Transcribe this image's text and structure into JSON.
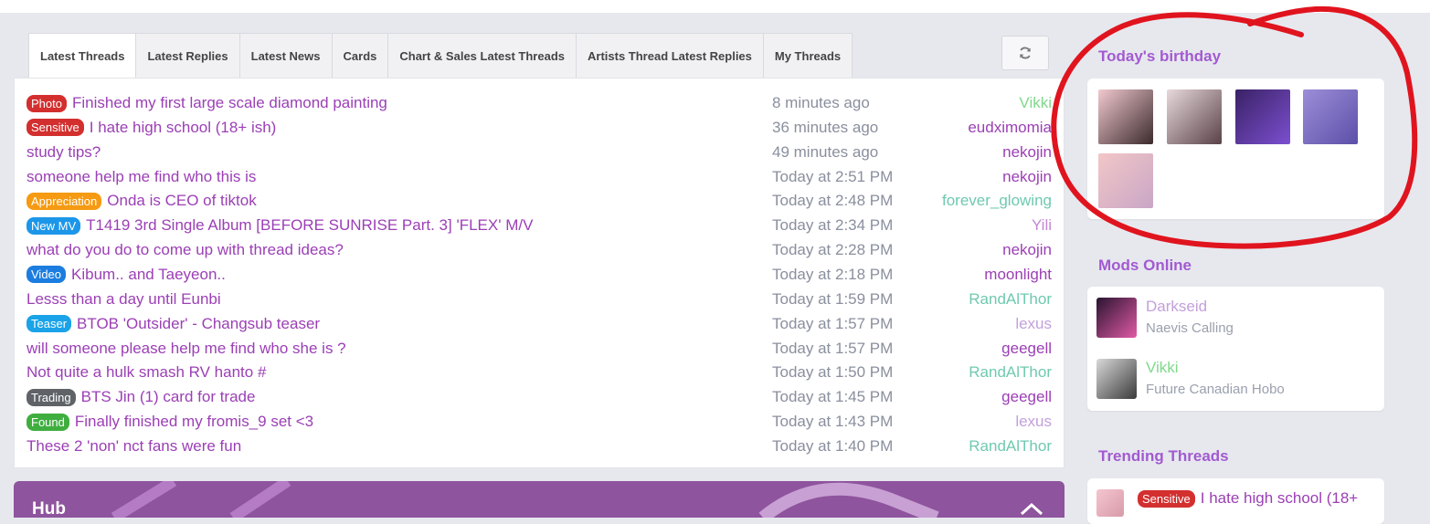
{
  "tabs": [
    "Latest Threads",
    "Latest Replies",
    "Latest News",
    "Cards",
    "Chart & Sales Latest Threads",
    "Artists Thread Latest Replies",
    "My Threads"
  ],
  "refresh_icon": "refresh-icon",
  "threads": [
    {
      "badge": "Photo",
      "badge_color": "#d32f2f",
      "title": "Finished my first large scale diamond painting",
      "time": "8 minutes ago",
      "user": "Vikki",
      "user_color": "#7fd98a"
    },
    {
      "badge": "Sensitive",
      "badge_color": "#d32f2f",
      "title": "I hate high school (18+ ish)",
      "time": "36 minutes ago",
      "user": "eudximomia",
      "user_color": "#9b3fb5"
    },
    {
      "badge": "",
      "badge_color": "",
      "title": "study tips?",
      "time": "49 minutes ago",
      "user": "nekojin",
      "user_color": "#9b3fb5"
    },
    {
      "badge": "",
      "badge_color": "",
      "title": "someone help me find who this is",
      "time": "Today at 2:51 PM",
      "user": "nekojin",
      "user_color": "#9b3fb5"
    },
    {
      "badge": "Appreciation",
      "badge_color": "#f59a12",
      "title": "Onda is CEO of tiktok",
      "time": "Today at 2:48 PM",
      "user": "forever_glowing",
      "user_color": "#6fc9b0"
    },
    {
      "badge": "New MV",
      "badge_color": "#1c96e8",
      "title": "T1419 3rd Single Album [BEFORE SUNRISE Part. 3] 'FLEX' M/V",
      "time": "Today at 2:34 PM",
      "user": "Yili",
      "user_color": "#c486d6"
    },
    {
      "badge": "",
      "badge_color": "",
      "title": "what do you do to come up with thread ideas?",
      "time": "Today at 2:28 PM",
      "user": "nekojin",
      "user_color": "#9b3fb5"
    },
    {
      "badge": "Video",
      "badge_color": "#1c7de0",
      "title": "Kibum.. and Taeyeon..",
      "time": "Today at 2:18 PM",
      "user": "moonlight",
      "user_color": "#9b3fb5"
    },
    {
      "badge": "",
      "badge_color": "",
      "title": "Lesss than a day until Eunbi",
      "time": "Today at 1:59 PM",
      "user": "RandAlThor",
      "user_color": "#6fc9b0"
    },
    {
      "badge": "Teaser",
      "badge_color": "#1aa3e8",
      "title": "BTOB 'Outsider' - Changsub teaser",
      "time": "Today at 1:57 PM",
      "user": "lexus",
      "user_color": "#c3a0dc"
    },
    {
      "badge": "",
      "badge_color": "",
      "title": "will someone please help me find who she is ?",
      "time": "Today at 1:57 PM",
      "user": "geegell",
      "user_color": "#9b3fb5"
    },
    {
      "badge": "",
      "badge_color": "",
      "title": "Not quite a hulk smash RV hanto #",
      "time": "Today at 1:50 PM",
      "user": "RandAlThor",
      "user_color": "#6fc9b0"
    },
    {
      "badge": "Trading",
      "badge_color": "#5f6368",
      "title": "BTS Jin (1) card for trade",
      "time": "Today at 1:45 PM",
      "user": "geegell",
      "user_color": "#9b3fb5"
    },
    {
      "badge": "Found",
      "badge_color": "#3fae3f",
      "title": "Finally finished my fromis_9 set <3",
      "time": "Today at 1:43 PM",
      "user": "lexus",
      "user_color": "#c3a0dc"
    },
    {
      "badge": "",
      "badge_color": "",
      "title": "These 2 'non' nct fans were fun",
      "time": "Today at 1:40 PM",
      "user": "RandAlThor",
      "user_color": "#6fc9b0"
    }
  ],
  "hub": {
    "title": "Hub"
  },
  "sidebar": {
    "birthday_heading": "Today's birthday",
    "birthday_avatars": [
      {
        "name": "birthday-avatar-1",
        "colors": [
          "#f1c9cf",
          "#3b2a2c"
        ]
      },
      {
        "name": "birthday-avatar-2",
        "colors": [
          "#e7d9dc",
          "#5a4247"
        ]
      },
      {
        "name": "birthday-avatar-3",
        "colors": [
          "#3a2266",
          "#7c4fd0"
        ]
      },
      {
        "name": "birthday-avatar-4",
        "colors": [
          "#9d8ed8",
          "#5c4fa8"
        ]
      },
      {
        "name": "birthday-avatar-5",
        "colors": [
          "#f2c7c7",
          "#c9a6c6"
        ]
      }
    ],
    "mods_heading": "Mods Online",
    "mods": [
      {
        "name": "Darkseid",
        "subtitle": "Naevis Calling",
        "color": "#c3a0dc",
        "avatar_colors": [
          "#2a1430",
          "#e05aa6"
        ]
      },
      {
        "name": "Vikki",
        "subtitle": "Future Canadian Hobo",
        "color": "#7fd98a",
        "avatar_colors": [
          "#d9d9d9",
          "#3a3a3a"
        ]
      }
    ],
    "trending_heading": "Trending Threads",
    "trending": [
      {
        "badge": "Sensitive",
        "title": "I hate high school (18+",
        "avatar_colors": [
          "#f4c6d0",
          "#d89aa8"
        ]
      }
    ]
  },
  "colors": {
    "accent": "#9b3fb5",
    "annotation_red": "#e0141e"
  }
}
